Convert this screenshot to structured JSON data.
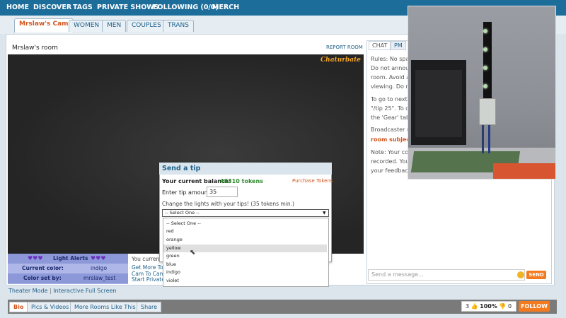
{
  "nav": {
    "items": [
      "HOME",
      "DISCOVER",
      "TAGS",
      "PRIVATE SHOWS",
      "FOLLOWING (0/0)",
      "MERCH"
    ]
  },
  "tabs": [
    "Mrslaw's Cam",
    "WOMEN",
    "MEN",
    "COUPLES",
    "TRANS"
  ],
  "room": {
    "title": "Mrslaw's room",
    "report": "REPORT ROOM",
    "logo": "Chaturbate"
  },
  "alerts": {
    "hearts": "♥♥♥",
    "title": "Light Alerts",
    "current_color_label": "Current color:",
    "current_color_value": "indigo",
    "set_by_label": "Color set by:",
    "set_by_value": "mrslaw_test"
  },
  "info_lines": [
    "You current",
    "Get More Tok",
    "Cam To Cam",
    "Start Private S"
  ],
  "theater": {
    "mode": "Theater Mode",
    "sep": "|",
    "fullscreen": "Interactive Full Screen"
  },
  "bottom_tabs": [
    "Bio",
    "Pics & Videos",
    "More Rooms Like This",
    "Share"
  ],
  "votes": {
    "up_count": "3",
    "thumb_up": "👍",
    "percent": "100%",
    "thumb_down": "👎",
    "down_count": "0"
  },
  "follow": "FOLLOW",
  "chat": {
    "tabs": [
      "CHAT",
      "PM"
    ],
    "lines": [
      "Rules: No spam",
      "Do not announ",
      "room. Avoid an",
      "viewing. Do not",
      "To go to next r",
      "\"/tip 25\". To d",
      "the 'Gear' tab a",
      "Broadcaster mrs",
      "Note: Your con",
      "recorded. You",
      "your feedback."
    ],
    "subject": "room subject",
    "placeholder": "Send a message...",
    "send": "SEND"
  },
  "tip": {
    "title": "Send a tip",
    "balance_label": "Your current balance:",
    "balance": "48310 tokens",
    "purchase": "Purchase Tokens",
    "amount_label": "Enter tip amount:",
    "amount": "35",
    "lights_text": "Change the lights with your tips! (35 tokens min.)",
    "selected": "-- Select One --",
    "options": [
      "-- Select One --",
      "red",
      "orange",
      "yellow",
      "green",
      "blue",
      "indigo",
      "violet"
    ],
    "hovered_option": "yellow"
  },
  "colors": {
    "nav_bg": "#1d6d9a",
    "accent": "#f47a1f",
    "alerts_bg": "#8c98d8",
    "balance_green": "#2f8a2f"
  }
}
